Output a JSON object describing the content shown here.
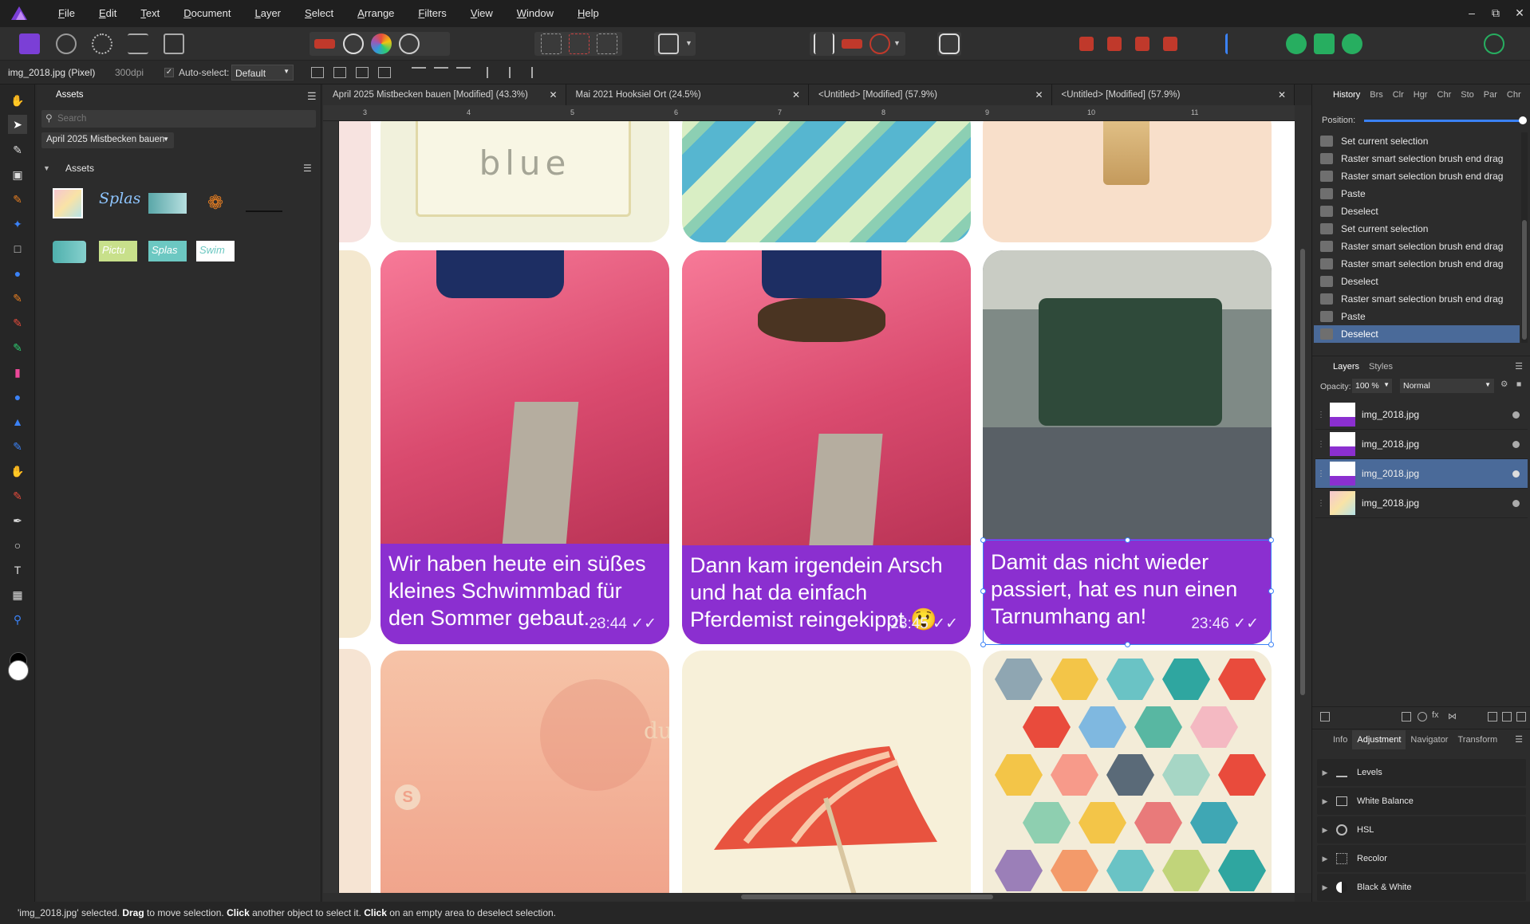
{
  "menu": [
    "File",
    "Edit",
    "Text",
    "Document",
    "Layer",
    "Select",
    "Arrange",
    "Filters",
    "View",
    "Window",
    "Help"
  ],
  "context": {
    "doc_label": "img_2018.jpg (Pixel)",
    "dpi": "300dpi",
    "autoselect_label": "Auto-select:",
    "autoselect_value": "Default"
  },
  "assets": {
    "tab": "Assets",
    "search_placeholder": "Search",
    "category": "April 2025 Mistbecken bauen",
    "section": "Assets"
  },
  "tabs": [
    "April 2025 Mistbecken bauen [Modified] (43.3%)",
    "Mai 2021 Hooksiel Ort (24.5%)",
    "<Untitled> [Modified] (57.9%)",
    "<Untitled> [Modified] (57.9%)"
  ],
  "ruler": [
    "3",
    "4",
    "5",
    "6",
    "7",
    "8",
    "9",
    "10",
    "11"
  ],
  "canvas": {
    "blue_label": "blue",
    "bubbles": [
      {
        "text": "Wir haben heute ein süßes kleines Schwimmbad für den Sommer gebaut...",
        "time": "23:44"
      },
      {
        "text": "Dann kam irgendein Arsch und hat da einfach Pferdemist reingekippt 😲",
        "time": "23:45"
      },
      {
        "text": "Damit das nicht wieder passiert, hat es nun einen Tarnumhang an!",
        "time": "23:46"
      }
    ],
    "paper_text_1": "du",
    "paper_text_2": "S"
  },
  "history": {
    "tabs": [
      "History",
      "Brs",
      "Clr",
      "Hgr",
      "Chr",
      "Sto",
      "Par",
      "Chr"
    ],
    "position_label": "Position:",
    "position_value": 1.0,
    "items": [
      "Set current selection",
      "Raster smart selection brush end drag",
      "Raster smart selection brush end drag",
      "Paste",
      "Deselect",
      "Set current selection",
      "Raster smart selection brush end drag",
      "Raster smart selection brush end drag",
      "Deselect",
      "Raster smart selection brush end drag",
      "Paste",
      "Deselect"
    ],
    "selected_index": 11
  },
  "layers": {
    "tabs": [
      "Layers",
      "Styles"
    ],
    "opacity_label": "Opacity:",
    "opacity_value": "100 %",
    "blend": "Normal",
    "items": [
      "img_2018.jpg",
      "img_2018.jpg",
      "img_2018.jpg",
      "img_2018.jpg"
    ],
    "selected_index": 2
  },
  "adjust": {
    "tabs": [
      "Info",
      "Adjustment",
      "Navigator",
      "Transform"
    ],
    "items": [
      "Levels",
      "White Balance",
      "HSL",
      "Recolor",
      "Black & White"
    ]
  },
  "status": {
    "p1": "'img_2018.jpg' selected. ",
    "b1": "Drag",
    "p2": " to move selection. ",
    "b2": "Click",
    "p3": " another object to select it. ",
    "b3": "Click",
    "p4": " on an empty area to deselect selection."
  },
  "colors": {
    "accent": "#4a6a99",
    "bubble": "#8b2fd0",
    "brand": "#7b3fd6"
  }
}
